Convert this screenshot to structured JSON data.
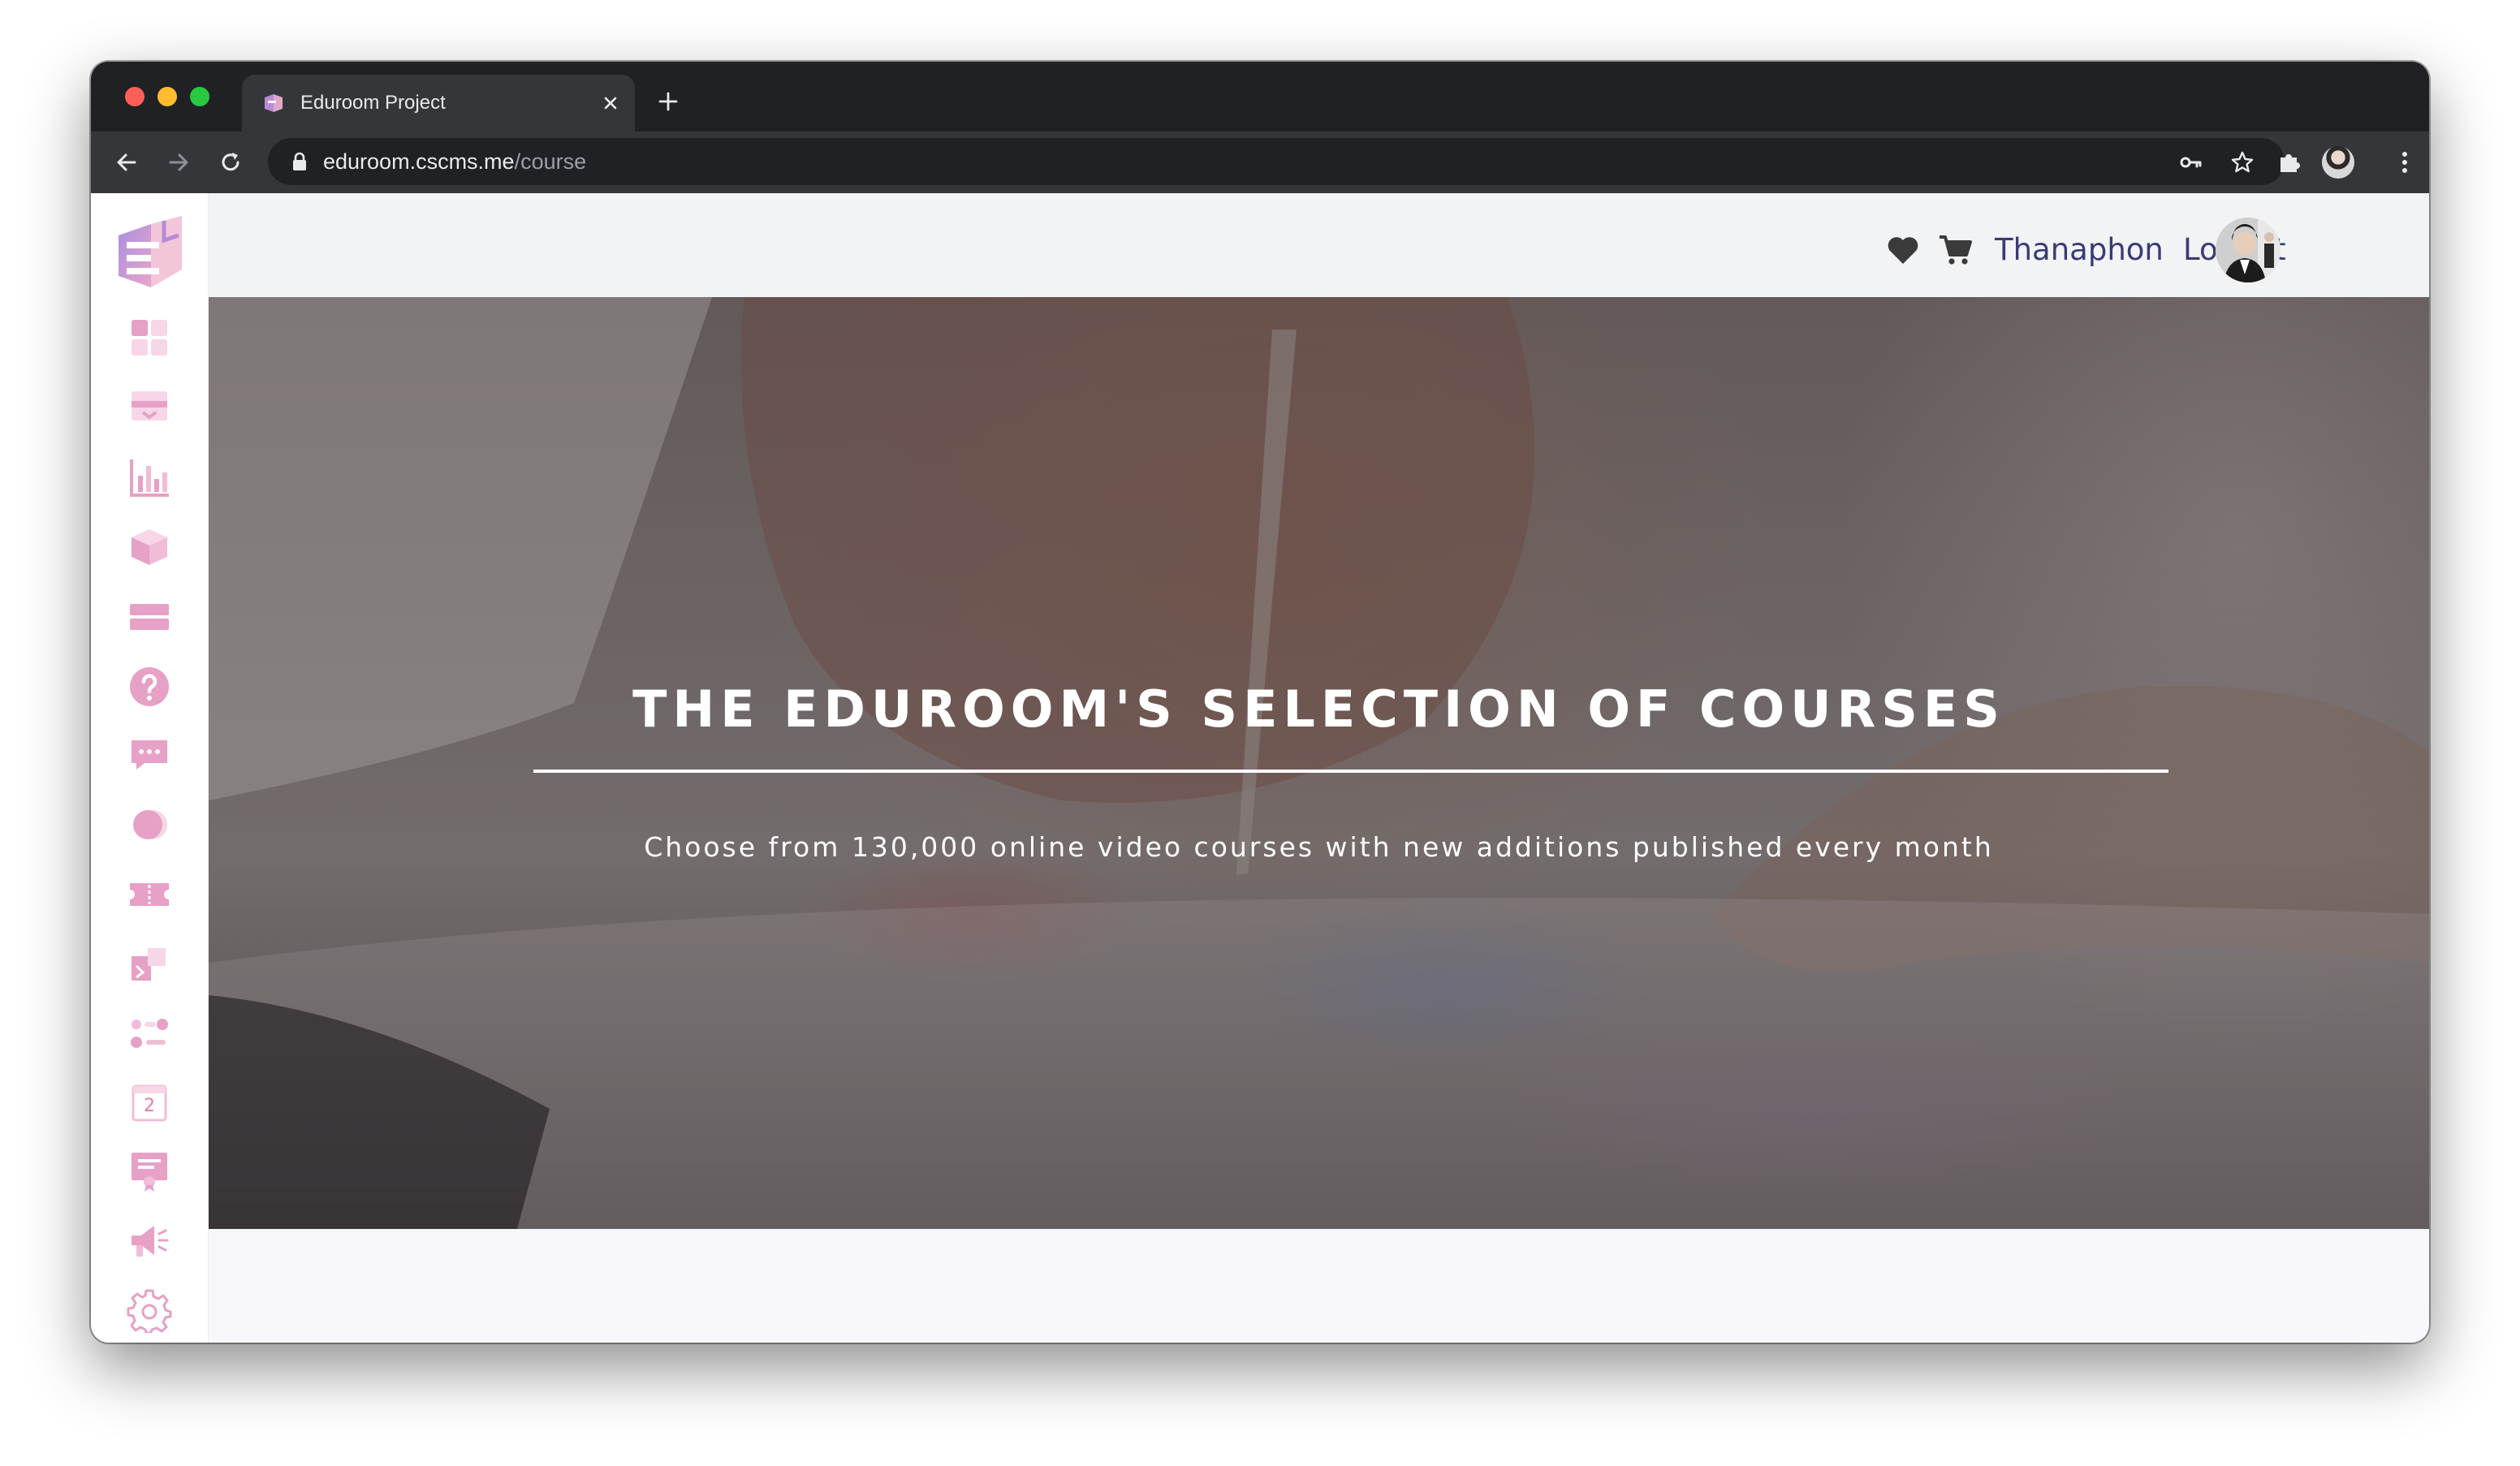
{
  "browser": {
    "tab_title": "Eduroom Project",
    "url_host": "eduroom.cscms.me",
    "url_path": "/course"
  },
  "header": {
    "username": "Thanaphon",
    "logout_label": "Logout"
  },
  "hero": {
    "title": "THE EDUROOM'S SELECTION OF COURSES",
    "subtitle": "Choose from 130,000 online video courses with new additions published every month"
  },
  "sidebar": {
    "items": [
      {
        "icon": "dashboard-icon"
      },
      {
        "icon": "inbox-icon"
      },
      {
        "icon": "chart-icon"
      },
      {
        "icon": "box-icon"
      },
      {
        "icon": "layers-icon"
      },
      {
        "icon": "help-icon"
      },
      {
        "icon": "chat-icon"
      },
      {
        "icon": "toggle-icon"
      },
      {
        "icon": "ticket-icon"
      },
      {
        "icon": "puzzle-icon"
      },
      {
        "icon": "settings-sliders-icon"
      },
      {
        "icon": "calendar-icon"
      },
      {
        "icon": "certificate-icon"
      },
      {
        "icon": "megaphone-icon"
      },
      {
        "icon": "gear-icon"
      }
    ],
    "calendar_day": "2"
  },
  "colors": {
    "sidebar_icon": "#e7a0c6",
    "header_link": "#3a3a75",
    "chrome_dark": "#202124"
  }
}
